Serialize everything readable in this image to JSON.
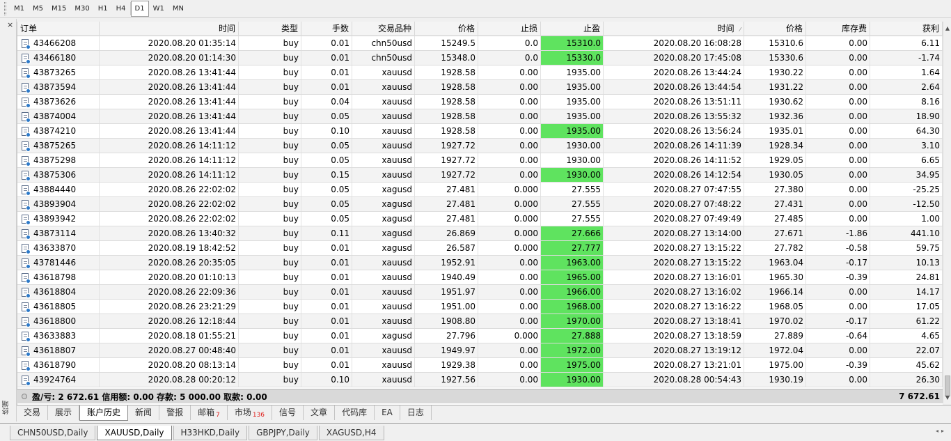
{
  "timeframes": [
    "M1",
    "M5",
    "M15",
    "M30",
    "H1",
    "H4",
    "D1",
    "W1",
    "MN"
  ],
  "active_timeframe": "D1",
  "terminal_label": "终端",
  "columns": [
    "订单",
    "时间",
    "类型",
    "手数",
    "交易品种",
    "价格",
    "止损",
    "止盈",
    "时间",
    "价格",
    "库存费",
    "获利"
  ],
  "sort_indicator": "⁄",
  "highlight_color": "#5fe35f",
  "rows": [
    {
      "order": "43466208",
      "open_time": "2020.08.20 01:35:14",
      "type": "buy",
      "lots": "0.01",
      "symbol": "chn50usd",
      "open_price": "15249.5",
      "sl": "0.0",
      "tp": "15310.0",
      "tp_hit": true,
      "close_time": "2020.08.20 16:08:28",
      "close_price": "15310.6",
      "swap": "0.00",
      "profit": "6.11"
    },
    {
      "order": "43466180",
      "open_time": "2020.08.20 01:14:30",
      "type": "buy",
      "lots": "0.01",
      "symbol": "chn50usd",
      "open_price": "15348.0",
      "sl": "0.0",
      "tp": "15330.0",
      "tp_hit": true,
      "close_time": "2020.08.20 17:45:08",
      "close_price": "15330.6",
      "swap": "0.00",
      "profit": "-1.74"
    },
    {
      "order": "43873265",
      "open_time": "2020.08.26 13:41:44",
      "type": "buy",
      "lots": "0.01",
      "symbol": "xauusd",
      "open_price": "1928.58",
      "sl": "0.00",
      "tp": "1935.00",
      "tp_hit": false,
      "close_time": "2020.08.26 13:44:24",
      "close_price": "1930.22",
      "swap": "0.00",
      "profit": "1.64"
    },
    {
      "order": "43873594",
      "open_time": "2020.08.26 13:41:44",
      "type": "buy",
      "lots": "0.01",
      "symbol": "xauusd",
      "open_price": "1928.58",
      "sl": "0.00",
      "tp": "1935.00",
      "tp_hit": false,
      "close_time": "2020.08.26 13:44:54",
      "close_price": "1931.22",
      "swap": "0.00",
      "profit": "2.64"
    },
    {
      "order": "43873626",
      "open_time": "2020.08.26 13:41:44",
      "type": "buy",
      "lots": "0.04",
      "symbol": "xauusd",
      "open_price": "1928.58",
      "sl": "0.00",
      "tp": "1935.00",
      "tp_hit": false,
      "close_time": "2020.08.26 13:51:11",
      "close_price": "1930.62",
      "swap": "0.00",
      "profit": "8.16"
    },
    {
      "order": "43874004",
      "open_time": "2020.08.26 13:41:44",
      "type": "buy",
      "lots": "0.05",
      "symbol": "xauusd",
      "open_price": "1928.58",
      "sl": "0.00",
      "tp": "1935.00",
      "tp_hit": false,
      "close_time": "2020.08.26 13:55:32",
      "close_price": "1932.36",
      "swap": "0.00",
      "profit": "18.90"
    },
    {
      "order": "43874210",
      "open_time": "2020.08.26 13:41:44",
      "type": "buy",
      "lots": "0.10",
      "symbol": "xauusd",
      "open_price": "1928.58",
      "sl": "0.00",
      "tp": "1935.00",
      "tp_hit": true,
      "close_time": "2020.08.26 13:56:24",
      "close_price": "1935.01",
      "swap": "0.00",
      "profit": "64.30"
    },
    {
      "order": "43875265",
      "open_time": "2020.08.26 14:11:12",
      "type": "buy",
      "lots": "0.05",
      "symbol": "xauusd",
      "open_price": "1927.72",
      "sl": "0.00",
      "tp": "1930.00",
      "tp_hit": false,
      "close_time": "2020.08.26 14:11:39",
      "close_price": "1928.34",
      "swap": "0.00",
      "profit": "3.10"
    },
    {
      "order": "43875298",
      "open_time": "2020.08.26 14:11:12",
      "type": "buy",
      "lots": "0.05",
      "symbol": "xauusd",
      "open_price": "1927.72",
      "sl": "0.00",
      "tp": "1930.00",
      "tp_hit": false,
      "close_time": "2020.08.26 14:11:52",
      "close_price": "1929.05",
      "swap": "0.00",
      "profit": "6.65"
    },
    {
      "order": "43875306",
      "open_time": "2020.08.26 14:11:12",
      "type": "buy",
      "lots": "0.15",
      "symbol": "xauusd",
      "open_price": "1927.72",
      "sl": "0.00",
      "tp": "1930.00",
      "tp_hit": true,
      "close_time": "2020.08.26 14:12:54",
      "close_price": "1930.05",
      "swap": "0.00",
      "profit": "34.95"
    },
    {
      "order": "43884440",
      "open_time": "2020.08.26 22:02:02",
      "type": "buy",
      "lots": "0.05",
      "symbol": "xagusd",
      "open_price": "27.481",
      "sl": "0.000",
      "tp": "27.555",
      "tp_hit": false,
      "close_time": "2020.08.27 07:47:55",
      "close_price": "27.380",
      "swap": "0.00",
      "profit": "-25.25"
    },
    {
      "order": "43893904",
      "open_time": "2020.08.26 22:02:02",
      "type": "buy",
      "lots": "0.05",
      "symbol": "xagusd",
      "open_price": "27.481",
      "sl": "0.000",
      "tp": "27.555",
      "tp_hit": false,
      "close_time": "2020.08.27 07:48:22",
      "close_price": "27.431",
      "swap": "0.00",
      "profit": "-12.50"
    },
    {
      "order": "43893942",
      "open_time": "2020.08.26 22:02:02",
      "type": "buy",
      "lots": "0.05",
      "symbol": "xagusd",
      "open_price": "27.481",
      "sl": "0.000",
      "tp": "27.555",
      "tp_hit": false,
      "close_time": "2020.08.27 07:49:49",
      "close_price": "27.485",
      "swap": "0.00",
      "profit": "1.00"
    },
    {
      "order": "43873114",
      "open_time": "2020.08.26 13:40:32",
      "type": "buy",
      "lots": "0.11",
      "symbol": "xagusd",
      "open_price": "26.869",
      "sl": "0.000",
      "tp": "27.666",
      "tp_hit": true,
      "close_time": "2020.08.27 13:14:00",
      "close_price": "27.671",
      "swap": "-1.86",
      "profit": "441.10"
    },
    {
      "order": "43633870",
      "open_time": "2020.08.19 18:42:52",
      "type": "buy",
      "lots": "0.01",
      "symbol": "xagusd",
      "open_price": "26.587",
      "sl": "0.000",
      "tp": "27.777",
      "tp_hit": true,
      "close_time": "2020.08.27 13:15:22",
      "close_price": "27.782",
      "swap": "-0.58",
      "profit": "59.75"
    },
    {
      "order": "43781446",
      "open_time": "2020.08.26 20:35:05",
      "type": "buy",
      "lots": "0.01",
      "symbol": "xauusd",
      "open_price": "1952.91",
      "sl": "0.00",
      "tp": "1963.00",
      "tp_hit": true,
      "close_time": "2020.08.27 13:15:22",
      "close_price": "1963.04",
      "swap": "-0.17",
      "profit": "10.13"
    },
    {
      "order": "43618798",
      "open_time": "2020.08.20 01:10:13",
      "type": "buy",
      "lots": "0.01",
      "symbol": "xauusd",
      "open_price": "1940.49",
      "sl": "0.00",
      "tp": "1965.00",
      "tp_hit": true,
      "close_time": "2020.08.27 13:16:01",
      "close_price": "1965.30",
      "swap": "-0.39",
      "profit": "24.81"
    },
    {
      "order": "43618804",
      "open_time": "2020.08.26 22:09:36",
      "type": "buy",
      "lots": "0.01",
      "symbol": "xauusd",
      "open_price": "1951.97",
      "sl": "0.00",
      "tp": "1966.00",
      "tp_hit": true,
      "close_time": "2020.08.27 13:16:02",
      "close_price": "1966.14",
      "swap": "0.00",
      "profit": "14.17"
    },
    {
      "order": "43618805",
      "open_time": "2020.08.26 23:21:29",
      "type": "buy",
      "lots": "0.01",
      "symbol": "xauusd",
      "open_price": "1951.00",
      "sl": "0.00",
      "tp": "1968.00",
      "tp_hit": true,
      "close_time": "2020.08.27 13:16:22",
      "close_price": "1968.05",
      "swap": "0.00",
      "profit": "17.05"
    },
    {
      "order": "43618800",
      "open_time": "2020.08.26 12:18:44",
      "type": "buy",
      "lots": "0.01",
      "symbol": "xauusd",
      "open_price": "1908.80",
      "sl": "0.00",
      "tp": "1970.00",
      "tp_hit": true,
      "close_time": "2020.08.27 13:18:41",
      "close_price": "1970.02",
      "swap": "-0.17",
      "profit": "61.22"
    },
    {
      "order": "43633883",
      "open_time": "2020.08.18 01:55:21",
      "type": "buy",
      "lots": "0.01",
      "symbol": "xagusd",
      "open_price": "27.796",
      "sl": "0.000",
      "tp": "27.888",
      "tp_hit": true,
      "close_time": "2020.08.27 13:18:59",
      "close_price": "27.889",
      "swap": "-0.64",
      "profit": "4.65"
    },
    {
      "order": "43618807",
      "open_time": "2020.08.27 00:48:40",
      "type": "buy",
      "lots": "0.01",
      "symbol": "xauusd",
      "open_price": "1949.97",
      "sl": "0.00",
      "tp": "1972.00",
      "tp_hit": true,
      "close_time": "2020.08.27 13:19:12",
      "close_price": "1972.04",
      "swap": "0.00",
      "profit": "22.07"
    },
    {
      "order": "43618790",
      "open_time": "2020.08.20 08:13:14",
      "type": "buy",
      "lots": "0.01",
      "symbol": "xauusd",
      "open_price": "1929.38",
      "sl": "0.00",
      "tp": "1975.00",
      "tp_hit": true,
      "close_time": "2020.08.27 13:21:01",
      "close_price": "1975.00",
      "swap": "-0.39",
      "profit": "45.62"
    },
    {
      "order": "43924764",
      "open_time": "2020.08.28 00:20:12",
      "type": "buy",
      "lots": "0.10",
      "symbol": "xauusd",
      "open_price": "1927.56",
      "sl": "0.00",
      "tp": "1930.00",
      "tp_hit": true,
      "close_time": "2020.08.28 00:54:43",
      "close_price": "1930.19",
      "swap": "0.00",
      "profit": "26.30"
    }
  ],
  "summary": {
    "text": "盈/亏: 2 672.61  信用额: 0.00  存款: 5 000.00  取款: 0.00",
    "total": "7 672.61"
  },
  "terminal_tabs": [
    {
      "label": "交易",
      "badge": ""
    },
    {
      "label": "展示",
      "badge": ""
    },
    {
      "label": "账户历史",
      "badge": "",
      "active": true
    },
    {
      "label": "新闻",
      "badge": ""
    },
    {
      "label": "警报",
      "badge": ""
    },
    {
      "label": "邮箱",
      "badge": "7"
    },
    {
      "label": "市场",
      "badge": "136"
    },
    {
      "label": "信号",
      "badge": ""
    },
    {
      "label": "文章",
      "badge": ""
    },
    {
      "label": "代码库",
      "badge": ""
    },
    {
      "label": "EA",
      "badge": ""
    },
    {
      "label": "日志",
      "badge": ""
    }
  ],
  "chart_tabs": [
    {
      "label": "CHN50USD,Daily"
    },
    {
      "label": "XAUUSD,Daily",
      "active": true
    },
    {
      "label": "H33HKD,Daily"
    },
    {
      "label": "GBPJPY,Daily"
    },
    {
      "label": "XAGUSD,H4"
    }
  ],
  "icons": {
    "close": "×",
    "scroll_up": "▲",
    "scroll_down": "▼",
    "tab_nav": "◂▸"
  }
}
